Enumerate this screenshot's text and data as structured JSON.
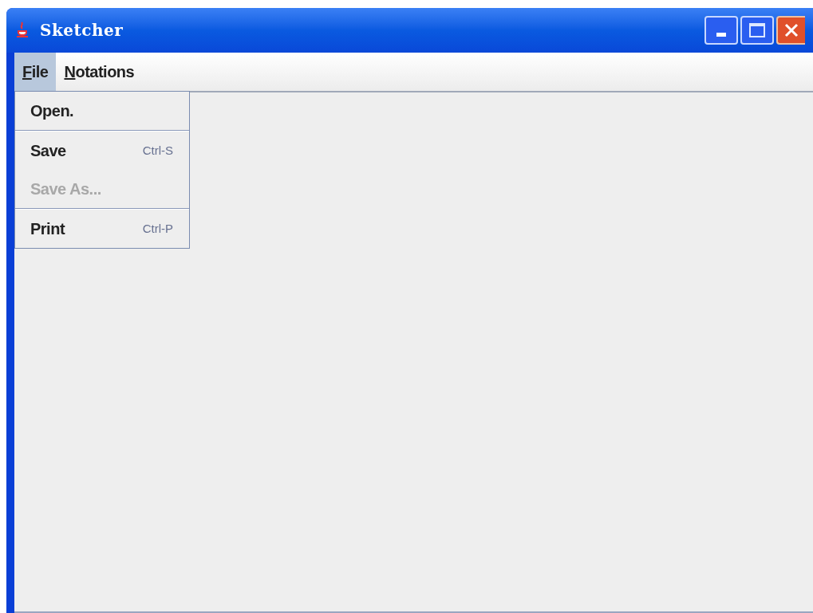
{
  "window": {
    "title": "Sketcher"
  },
  "menu_bar": [
    {
      "label": "File",
      "selected": true,
      "mnemonic": true
    },
    {
      "label": "Notations",
      "selected": false,
      "mnemonic": true
    }
  ],
  "file_menu": [
    {
      "kind": "item",
      "label": "Open.",
      "disabled": false
    },
    {
      "kind": "separator"
    },
    {
      "kind": "item",
      "label": "Save",
      "shortcut": "Ctrl-S",
      "disabled": false
    },
    {
      "kind": "item",
      "label": "Save As...",
      "disabled": true
    },
    {
      "kind": "separator"
    },
    {
      "kind": "item",
      "label": "Print",
      "shortcut": "Ctrl-P",
      "disabled": false
    }
  ]
}
